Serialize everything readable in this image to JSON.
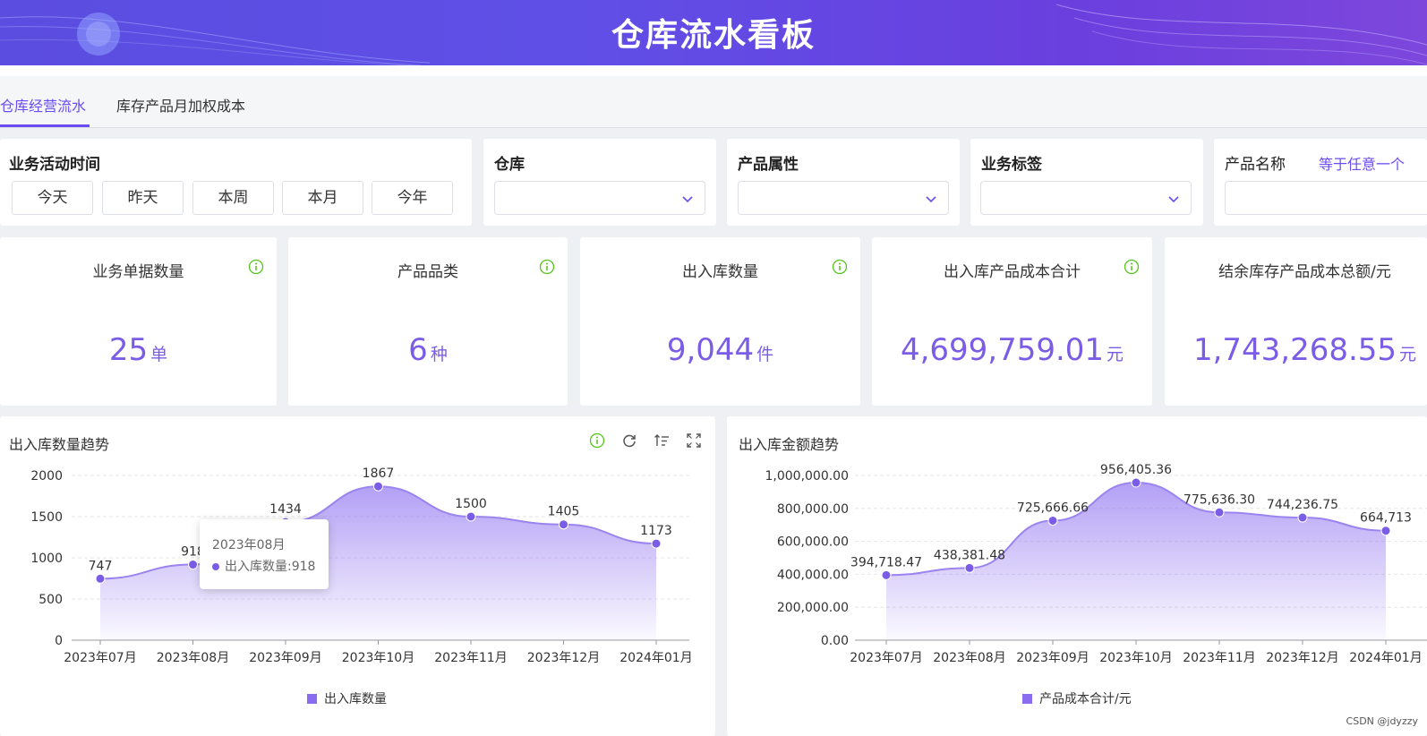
{
  "header": {
    "title": "仓库流水看板"
  },
  "tabs": [
    {
      "label": "仓库经营流水",
      "active": true
    },
    {
      "label": "库存产品月加权成本",
      "active": false
    }
  ],
  "filters": {
    "date": {
      "label": "业务活动时间",
      "buttons": [
        "今天",
        "昨天",
        "本周",
        "本月",
        "今年"
      ]
    },
    "warehouse": {
      "label": "仓库",
      "value": ""
    },
    "product_attr": {
      "label": "产品属性",
      "value": ""
    },
    "business_tag": {
      "label": "业务标签",
      "value": ""
    },
    "product_name": {
      "label": "产品名称",
      "mode": "等于任意一个",
      "value": ""
    }
  },
  "kpis": [
    {
      "title": "业务单据数量",
      "value": "25",
      "unit": "单"
    },
    {
      "title": "产品品类",
      "value": "6",
      "unit": "种"
    },
    {
      "title": "出入库数量",
      "value": "9,044",
      "unit": "件"
    },
    {
      "title": "出入库产品成本合计",
      "value": "4,699,759.01",
      "unit": "元"
    },
    {
      "title": "结余库存产品成本总额/元",
      "value": "1,743,268.55",
      "unit": "元"
    }
  ],
  "charts": {
    "qty": {
      "title": "出入库数量趋势"
    },
    "amount": {
      "title": "出入库金额趋势"
    }
  },
  "tooltip": {
    "title": "2023年08月",
    "series": "出入库数量",
    "value": "918"
  },
  "watermark": "CSDN @jdyzzy",
  "colors": {
    "accent": "#6a4cf0",
    "series": "#7b5ce6",
    "info": "#52c41a"
  },
  "chart_data": [
    {
      "type": "area",
      "title": "出入库数量趋势",
      "categories": [
        "2023年07月",
        "2023年08月",
        "2023年09月",
        "2023年10月",
        "2023年11月",
        "2023年12月",
        "2024年01月"
      ],
      "series": [
        {
          "name": "出入库数量",
          "values": [
            747,
            918,
            1434,
            1867,
            1500,
            1405,
            1173
          ]
        }
      ],
      "data_labels": [
        "747",
        "918",
        "1434",
        "1867",
        "1500",
        "1405",
        "1173"
      ],
      "ylim": [
        0,
        2000
      ],
      "yticks": [
        "0",
        "500",
        "1000",
        "1500",
        "2000"
      ],
      "grid": true,
      "legend": "bottom"
    },
    {
      "type": "area",
      "title": "出入库金额趋势",
      "categories": [
        "2023年07月",
        "2023年08月",
        "2023年09月",
        "2023年10月",
        "2023年11月",
        "2023年12月",
        "2024年01月"
      ],
      "series": [
        {
          "name": "产品成本合计/元",
          "values": [
            394718.47,
            438381.48,
            725666.66,
            956405.36,
            775636.3,
            744236.75,
            664713
          ]
        }
      ],
      "data_labels": [
        "394,718.47",
        "438,381.48",
        "725,666.66",
        "956,405.36",
        "775,636.30",
        "744,236.75",
        "664,713"
      ],
      "ylim": [
        0,
        1000000
      ],
      "yticks": [
        "0.00",
        "200,000.00",
        "400,000.00",
        "600,000.00",
        "800,000.00",
        "1,000,000.00"
      ],
      "grid": true,
      "legend": "bottom"
    }
  ]
}
